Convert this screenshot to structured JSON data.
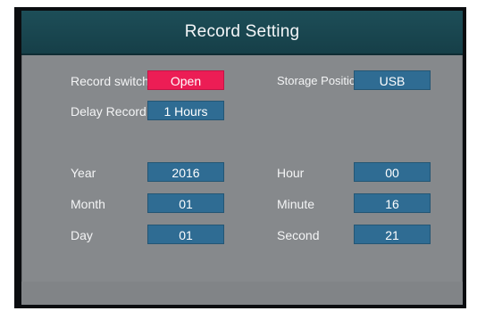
{
  "header": {
    "title": "Record Setting"
  },
  "settings": {
    "record_switch": {
      "label": "Record switch",
      "value": "Open",
      "color": "#ec1d55"
    },
    "delay_record": {
      "label": "Delay Record",
      "value": "1 Hours"
    },
    "storage_position": {
      "label": "Storage Position",
      "value": "USB"
    }
  },
  "datetime": {
    "year": {
      "label": "Year",
      "value": "2016"
    },
    "month": {
      "label": "Month",
      "value": "01"
    },
    "day": {
      "label": "Day",
      "value": "01"
    },
    "hour": {
      "label": "Hour",
      "value": "00"
    },
    "minute": {
      "label": "Minute",
      "value": "16"
    },
    "second": {
      "label": "Second",
      "value": "21"
    }
  },
  "colors": {
    "field_blue": "#2f6c93",
    "title_bar": "#1d4e58",
    "panel_gray": "#86898c"
  }
}
